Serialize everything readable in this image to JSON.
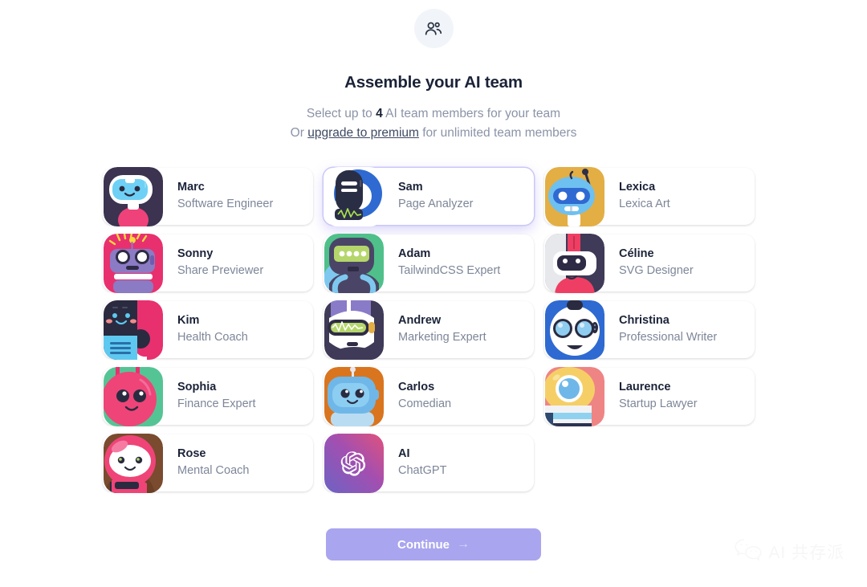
{
  "header": {
    "icon": "users-group-icon",
    "title": "Assemble your AI team",
    "subtitle_prefix": "Select up to ",
    "subtitle_count": "4",
    "subtitle_suffix": " AI team members for your team",
    "subtitle2_prefix": "Or ",
    "premium_link": "upgrade to premium",
    "subtitle2_suffix": " for unlimited team members"
  },
  "members": [
    {
      "name": "Marc",
      "role": "Software Engineer",
      "avatar": "marc",
      "selected": false
    },
    {
      "name": "Sam",
      "role": "Page Analyzer",
      "avatar": "sam",
      "selected": true
    },
    {
      "name": "Lexica",
      "role": "Lexica Art",
      "avatar": "lexica",
      "selected": false
    },
    {
      "name": "Sonny",
      "role": "Share Previewer",
      "avatar": "sonny",
      "selected": false
    },
    {
      "name": "Adam",
      "role": "TailwindCSS Expert",
      "avatar": "adam",
      "selected": false
    },
    {
      "name": "Céline",
      "role": "SVG Designer",
      "avatar": "celine",
      "selected": false
    },
    {
      "name": "Kim",
      "role": "Health Coach",
      "avatar": "kim",
      "selected": false
    },
    {
      "name": "Andrew",
      "role": "Marketing Expert",
      "avatar": "andrew",
      "selected": false
    },
    {
      "name": "Christina",
      "role": "Professional Writer",
      "avatar": "christina",
      "selected": false
    },
    {
      "name": "Sophia",
      "role": "Finance Expert",
      "avatar": "sophia",
      "selected": false
    },
    {
      "name": "Carlos",
      "role": "Comedian",
      "avatar": "carlos",
      "selected": false
    },
    {
      "name": "Laurence",
      "role": "Startup Lawyer",
      "avatar": "laurence",
      "selected": false
    },
    {
      "name": "Rose",
      "role": "Mental Coach",
      "avatar": "rose",
      "selected": false
    },
    {
      "name": "AI",
      "role": "ChatGPT",
      "avatar": "chatgpt",
      "selected": false
    }
  ],
  "footer": {
    "continue_label": "Continue",
    "continue_arrow": "→"
  },
  "watermark": {
    "icon": "wechat-icon",
    "text": "AI 共存派"
  },
  "colors": {
    "accent": "#a9a5ef",
    "title": "#1b2338",
    "muted": "#8b93a7",
    "card_bg": "#ffffff",
    "selected_ring": "#c9c7f7",
    "icon_bubble": "#f1f5f9"
  }
}
